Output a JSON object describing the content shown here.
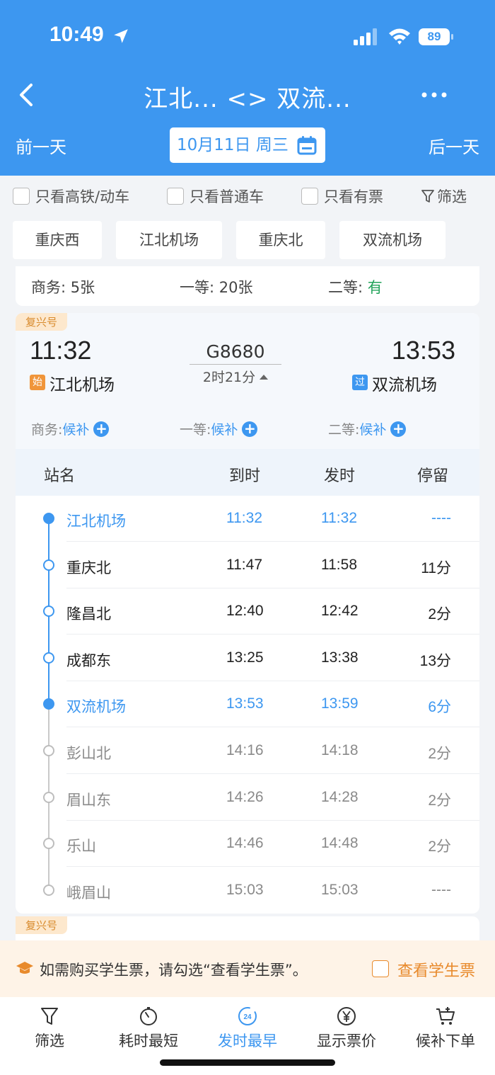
{
  "status_bar": {
    "time": "10:49",
    "battery": "89"
  },
  "header": {
    "title": "江北... <> 双流...",
    "prev_day": "前一天",
    "next_day": "后一天",
    "date": "10月11日 周三"
  },
  "filters": {
    "high_speed": "只看高铁/动车",
    "regular": "只看普通车",
    "available": "只看有票",
    "filter": "筛选"
  },
  "station_tabs": [
    "重庆西",
    "江北机场",
    "重庆北",
    "双流机场"
  ],
  "prev_card_seats": {
    "business": {
      "label": "商务:",
      "value": "5张"
    },
    "first": {
      "label": "一等:",
      "value": "20张"
    },
    "second": {
      "label": "二等:",
      "value": "有"
    }
  },
  "train": {
    "brand": "复兴号",
    "number": "G8680",
    "duration": "2时21分",
    "dep_time": "11:32",
    "arr_time": "13:53",
    "dep_badge": "始",
    "arr_badge": "过",
    "dep_station": "江北机场",
    "arr_station": "双流机场",
    "seats": [
      {
        "label": "商务:",
        "status": "候补"
      },
      {
        "label": "一等:",
        "status": "候补"
      },
      {
        "label": "二等:",
        "status": "候补"
      }
    ]
  },
  "stops_table": {
    "headers": {
      "station": "站名",
      "arrive": "到时",
      "depart": "发时",
      "stay": "停留"
    },
    "rows": [
      {
        "station": "江北机场",
        "arrive": "11:32",
        "depart": "11:32",
        "stay": "----",
        "state": "endpoint"
      },
      {
        "station": "重庆北",
        "arrive": "11:47",
        "depart": "11:58",
        "stay": "11分",
        "state": "onroute"
      },
      {
        "station": "隆昌北",
        "arrive": "12:40",
        "depart": "12:42",
        "stay": "2分",
        "state": "onroute"
      },
      {
        "station": "成都东",
        "arrive": "13:25",
        "depart": "13:38",
        "stay": "13分",
        "state": "onroute"
      },
      {
        "station": "双流机场",
        "arrive": "13:53",
        "depart": "13:59",
        "stay": "6分",
        "state": "endpoint"
      },
      {
        "station": "彭山北",
        "arrive": "14:16",
        "depart": "14:18",
        "stay": "2分",
        "state": "after"
      },
      {
        "station": "眉山东",
        "arrive": "14:26",
        "depart": "14:28",
        "stay": "2分",
        "state": "after"
      },
      {
        "station": "乐山",
        "arrive": "14:46",
        "depart": "14:48",
        "stay": "2分",
        "state": "after"
      },
      {
        "station": "峨眉山",
        "arrive": "15:03",
        "depart": "15:03",
        "stay": "----",
        "state": "after"
      }
    ]
  },
  "next_card": {
    "brand": "复兴号"
  },
  "student": {
    "notice": "如需购买学生票，请勾选“查看学生票”。",
    "link": "查看学生票"
  },
  "bottom_nav": [
    {
      "label": "筛选",
      "icon": "filter-icon"
    },
    {
      "label": "耗时最短",
      "icon": "timer-icon"
    },
    {
      "label": "发时最早",
      "icon": "clock-24-icon",
      "active": true,
      "badge": "24"
    },
    {
      "label": "显示票价",
      "icon": "yen-icon"
    },
    {
      "label": "候补下单",
      "icon": "cart-plus-icon"
    }
  ],
  "colors": {
    "primary": "#3d97f0",
    "accent_orange": "#e88a2c",
    "available_green": "#22a35a"
  }
}
